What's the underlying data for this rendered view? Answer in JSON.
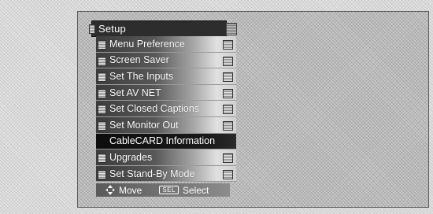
{
  "menu": {
    "title": "Setup",
    "items": [
      {
        "label": "Menu Preference"
      },
      {
        "label": "Screen Saver"
      },
      {
        "label": "Set The Inputs"
      },
      {
        "label": "Set AV NET"
      },
      {
        "label": "Set Closed Captions"
      },
      {
        "label": "Set Monitor Out"
      },
      {
        "label": "CableCARD Information",
        "selected": true
      },
      {
        "label": "Upgrades"
      },
      {
        "label": "Set Stand-By Mode"
      }
    ]
  },
  "footer": {
    "move_icon": "four-way-arrow-icon",
    "move_label": "Move",
    "sel_key_label": "SEL",
    "select_label": "Select"
  },
  "colors": {
    "title_bar": "#2d2d2d",
    "selected_item": "#111111",
    "item_text": "#ffffff"
  }
}
